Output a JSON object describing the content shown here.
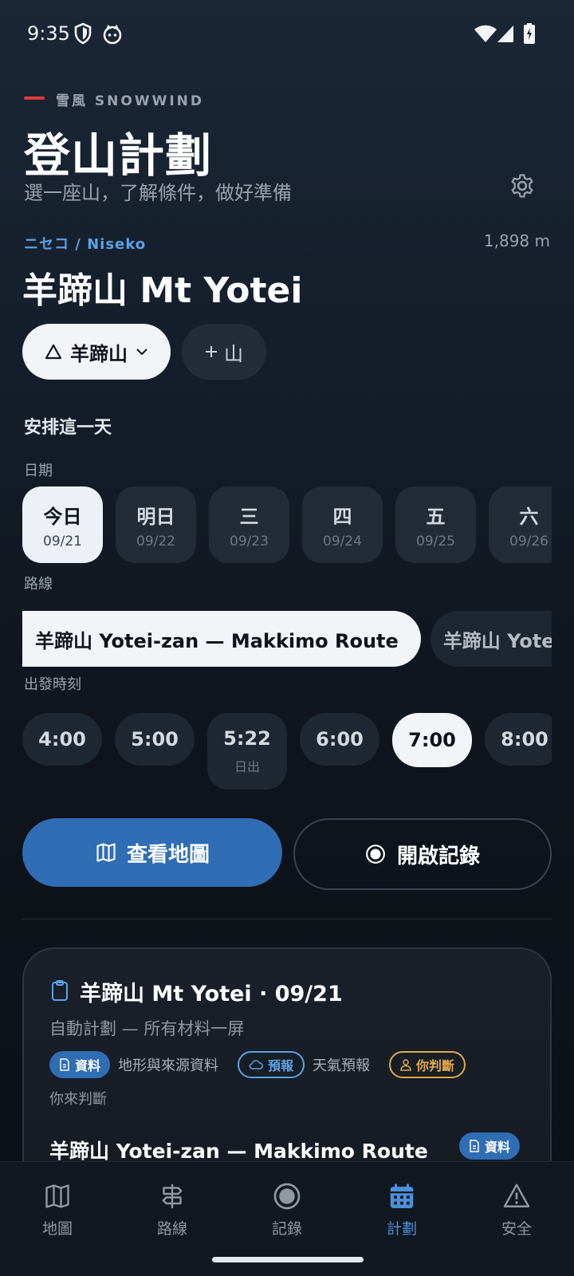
{
  "status_bar": {
    "time": "9:35"
  },
  "brand": {
    "label": "雪風 SNOWWIND"
  },
  "header": {
    "title": "登山計劃",
    "subtitle": "選一座山，了解條件，做好準備"
  },
  "mountain": {
    "region": "ニセコ / Niseko",
    "elevation": "1,898 m",
    "name": "羊蹄山 Mt Yotei",
    "selector_label": "羊蹄山",
    "add_label": "山"
  },
  "plan_day": {
    "section_title": "安排這一天",
    "date_label": "日期",
    "dates": [
      {
        "day": "今日",
        "date": "09/21"
      },
      {
        "day": "明日",
        "date": "09/22"
      },
      {
        "day": "三",
        "date": "09/23"
      },
      {
        "day": "四",
        "date": "09/24"
      },
      {
        "day": "五",
        "date": "09/25"
      },
      {
        "day": "六",
        "date": "09/26"
      }
    ],
    "route_label": "路線",
    "routes": [
      "羊蹄山 Yotei-zan — Makkimo Route",
      "羊蹄山 Yotei-zan — Hirafu Route"
    ],
    "departure_label": "出發時刻",
    "times": [
      {
        "time": "4:00",
        "sub": ""
      },
      {
        "time": "5:00",
        "sub": ""
      },
      {
        "time": "5:22",
        "sub": "日出"
      },
      {
        "time": "6:00",
        "sub": ""
      },
      {
        "time": "7:00",
        "sub": ""
      },
      {
        "time": "8:00",
        "sub": ""
      }
    ]
  },
  "actions": {
    "map_label": "查看地圖",
    "record_label": "開啟記錄"
  },
  "plan_card": {
    "title": "羊蹄山 Mt Yotei · 09/21",
    "subtitle": "自動計劃 — 所有材料一屏",
    "badge_data": "資料",
    "legend_data": "地形與來源資料",
    "badge_forecast": "預報",
    "legend_forecast": "天氣預報",
    "badge_judge": "你判斷",
    "legend_judge": "你來判斷",
    "route_title": "羊蹄山 Yotei-zan — Makkimo Route",
    "route_badge": "資料"
  },
  "bottom_nav": {
    "items": [
      {
        "label": "地圖",
        "icon": "map-icon"
      },
      {
        "label": "路線",
        "icon": "route-icon"
      },
      {
        "label": "記錄",
        "icon": "record-icon"
      },
      {
        "label": "計劃",
        "icon": "calendar-icon"
      },
      {
        "label": "安全",
        "icon": "warning-icon"
      }
    ]
  },
  "colors": {
    "accent": "#2f6db5",
    "brand_bar": "#e03b3b",
    "forecast": "#5aa2e6",
    "judge": "#e0a94a"
  }
}
